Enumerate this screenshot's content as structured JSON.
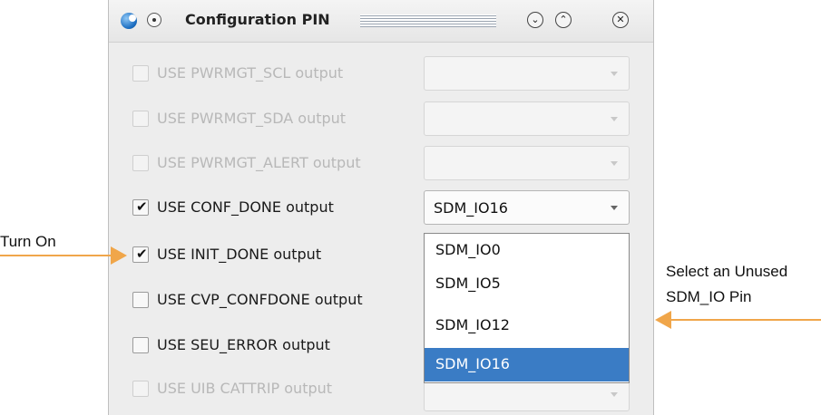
{
  "dialog": {
    "title": "Configuration PIN",
    "controls": {
      "minimize": "⌄",
      "maximize": "⌃",
      "close": "✕"
    }
  },
  "rows": [
    {
      "label": "USE PWRMGT_SCL output",
      "checked": false,
      "disabled": true,
      "combo_value": ""
    },
    {
      "label": "USE PWRMGT_SDA output",
      "checked": false,
      "disabled": true,
      "combo_value": ""
    },
    {
      "label": "USE PWRMGT_ALERT output",
      "checked": false,
      "disabled": true,
      "combo_value": ""
    },
    {
      "label": "USE CONF_DONE output",
      "checked": true,
      "disabled": false,
      "combo_value": "SDM_IO16"
    },
    {
      "label": "USE INIT_DONE output",
      "checked": true,
      "disabled": false
    },
    {
      "label": "USE CVP_CONFDONE output",
      "checked": false,
      "disabled": false
    },
    {
      "label": "USE SEU_ERROR output",
      "checked": false,
      "disabled": false
    },
    {
      "label": "USE UIB CATTRIP output",
      "checked": false,
      "disabled": true
    }
  ],
  "dropdown": {
    "options": [
      "SDM_IO0",
      "SDM_IO5",
      "SDM_IO12",
      "SDM_IO16"
    ],
    "selected": "SDM_IO16",
    "highlight_color": "#3a7cc5"
  },
  "annotations": {
    "turn_on": "Turn On",
    "select_line1": "Select an Unused",
    "select_line2": "SDM_IO Pin",
    "arrow_color": "#f0a64a"
  }
}
